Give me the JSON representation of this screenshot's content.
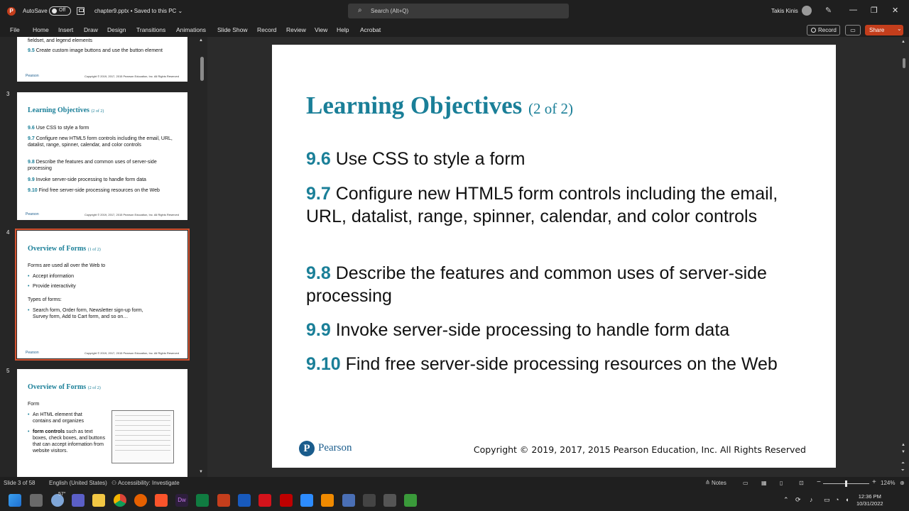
{
  "titlebar": {
    "app_letter": "P",
    "autosave_label": "AutoSave",
    "autosave_state": "Off",
    "file_title": "chapter9.pptx • Saved to this PC ⌄",
    "search_placeholder": "Search (Alt+Q)",
    "user_name": "Takis Kinis",
    "minimize": "—",
    "restore": "❐",
    "close": "✕"
  },
  "ribbon": {
    "tabs": [
      "File",
      "Home",
      "Insert",
      "Draw",
      "Design",
      "Transitions",
      "Animations",
      "Slide Show",
      "Record",
      "Review",
      "View",
      "Help",
      "Acrobat"
    ],
    "record_label": "Record",
    "share_label": "Share",
    "share_chevron": "⌄"
  },
  "thumbnails": {
    "slide2": {
      "lines": [
        "fieldset, and legend elements",
        "Create custom image buttons and use the button element"
      ],
      "num": "9.5",
      "footer_logo": "Pearson",
      "footer_copy": "Copyright © 2019, 2017, 2015 Pearson Education, Inc. All Rights Reserved"
    },
    "slide3": {
      "number": "3",
      "title": "Learning Objectives",
      "title_suffix": "(2 of 2)",
      "items": [
        {
          "num": "9.6",
          "text": "Use CSS to style a form"
        },
        {
          "num": "9.7",
          "text": "Configure new HTML5 form controls including the email, URL, datalist, range, spinner, calendar, and color controls"
        },
        {
          "num": "9.8",
          "text": "Describe the features and common uses of server-side processing"
        },
        {
          "num": "9.9",
          "text": "Invoke server-side processing to handle form data"
        },
        {
          "num": "9.10",
          "text": "Find free server-side processing resources on the Web"
        }
      ],
      "footer_logo": "Pearson",
      "footer_copy": "Copyright © 2019, 2017, 2015 Pearson Education, Inc. All Rights Reserved"
    },
    "slide4": {
      "number": "4",
      "title": "Overview of Forms",
      "title_suffix": "(1 of 2)",
      "intro": "Forms are used all over the Web to",
      "bullets": [
        "Accept information",
        "Provide interactivity"
      ],
      "types_label": "Types of forms:",
      "types_bullet": "Search form, Order form, Newsletter sign-up form, Survey form, Add to Cart form, and so on…",
      "footer_logo": "Pearson",
      "footer_copy": "Copyright © 2019, 2017, 2015 Pearson Education, Inc. All Rights Reserved"
    },
    "slide5": {
      "number": "5",
      "title": "Overview of Forms",
      "title_suffix": "(2 of 2)",
      "intro": "Form",
      "bullet1": "An HTML element that contains and organizes",
      "bullet2_bold": "form controls",
      "bullet2_rest": " such as text boxes, check boxes, and buttons that can accept information from website visitors."
    }
  },
  "slide": {
    "title": "Learning Objectives",
    "title_suffix": "(2 of 2)",
    "objectives": [
      {
        "num": "9.6",
        "text": "Use CSS to style a form"
      },
      {
        "num": "9.7",
        "text": "Configure new HTML5 form controls including the email, URL, datalist, range, spinner, calendar, and color controls"
      },
      {
        "num": "9.8",
        "text": "Describe the features and common uses of server-side processing"
      },
      {
        "num": "9.9",
        "text": "Invoke server-side processing to handle form data"
      },
      {
        "num": "9.10",
        "text": "Find free server-side processing resources on the Web"
      }
    ],
    "logo_letter": "P",
    "logo_text": "Pearson",
    "copyright": "Copyright © 2019, 2017, 2015 Pearson Education, Inc. All Rights Reserved"
  },
  "statusbar": {
    "slide_count": "Slide 3 of 58",
    "language": "English (United States)",
    "accessibility": "Accessibility: Investigate",
    "notes": "Notes",
    "zoom": "124%",
    "zoom_minus": "−",
    "zoom_plus": "+"
  },
  "taskbar": {
    "weather_temp": "57°",
    "time": "12:36 PM",
    "date": "10/31/2022"
  }
}
